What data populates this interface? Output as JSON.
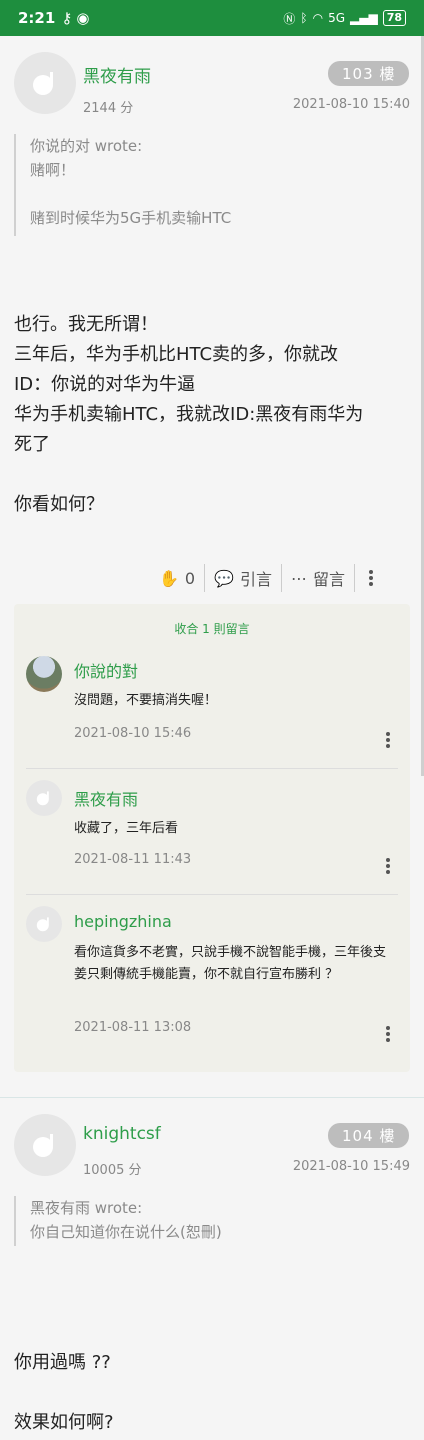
{
  "status_bar": {
    "time": "2:21",
    "battery": "78",
    "network": "5G"
  },
  "post1": {
    "author": "黑夜有雨",
    "floor": "103 樓",
    "points": "2144 分",
    "datetime": "2021-08-10 15:40",
    "quote_header": "你说的对 wrote:",
    "quote_line1": "赌啊！",
    "quote_line2": "赌到时候华为5G手机卖输HTC",
    "body_lines": [
      "也行。我无所谓！",
      "三年后，华为手机比HTC卖的多，你就改",
      "ID：你说的对华为牛逼",
      "华为手机卖输HTC，我就改ID:黑夜有雨华为",
      "死了",
      "",
      "你看如何？"
    ],
    "likes": "0",
    "quote_label": "引言",
    "comment_label": "留言"
  },
  "comments": {
    "collapse_label": "收合 1 則留言",
    "items": [
      {
        "name": "你說的對",
        "text": "沒問題，不要搞消失喔！",
        "time": "2021-08-10 15:46"
      },
      {
        "name": "黑夜有雨",
        "text": "收藏了，三年后看",
        "time": "2021-08-11 11:43"
      },
      {
        "name": "hepingzhina",
        "text": "看你這貨多不老實，只說手機不說智能手機，三年後支姜只剩傳統手機能賣，你不就自行宣布勝利 ？",
        "time": "2021-08-11 13:08"
      }
    ]
  },
  "post2": {
    "author": "knightcsf",
    "floor": "104 樓",
    "points": "10005 分",
    "datetime": "2021-08-10 15:49",
    "quote_header": "黑夜有雨 wrote:",
    "quote_line1": "你自己知道你在说什么(恕刪)",
    "body_line1": "你用過嗎 ??",
    "body_line2": "效果如何啊?"
  },
  "colors": {
    "brand": "#1e8e3e",
    "name": "#2e9d4a",
    "floor_badge": "#bdbdbd"
  },
  "icons": [
    "key-icon",
    "eye-icon",
    "nfc-icon",
    "bluetooth-icon",
    "wifi-icon",
    "signal-icon",
    "clap-icon",
    "quote-bubble-icon",
    "comment-bubble-icon",
    "more-icon"
  ]
}
